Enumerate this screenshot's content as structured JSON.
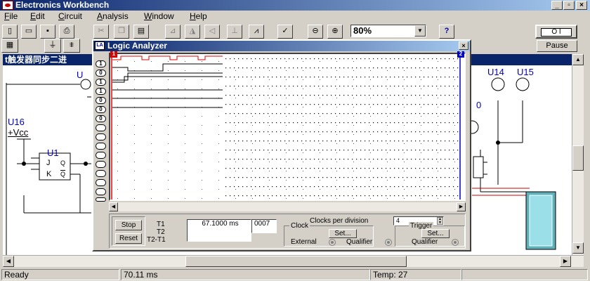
{
  "app": {
    "title": "Electronics Workbench",
    "circuit_title": "t触发器同步二进"
  },
  "menu": [
    {
      "label": "File",
      "u": "F",
      "rest": "ile"
    },
    {
      "label": "Edit",
      "u": "E",
      "rest": "dit"
    },
    {
      "label": "Circuit",
      "u": "C",
      "rest": "ircuit"
    },
    {
      "label": "Analysis",
      "u": "A",
      "rest": "nalysis"
    },
    {
      "label": "Window",
      "u": "W",
      "rest": "indow"
    },
    {
      "label": "Help",
      "u": "H",
      "rest": "elp"
    }
  ],
  "toolbar": {
    "zoom": "80%",
    "help_icon": "?",
    "pause_label": "Pause",
    "power_label": "O I"
  },
  "circuit": {
    "labels": {
      "u16": "U16",
      "vcc": "+Vcc",
      "u1": "U1",
      "u_left": "U",
      "u14": "U14",
      "u15": "U15",
      "zero": "0"
    },
    "ff": {
      "j": "J",
      "k": "K",
      "q": "Q",
      "qbar": "Q"
    }
  },
  "logic_analyzer": {
    "title": "Logic Analyzer",
    "marker1": "1",
    "marker2": "2",
    "channel_values": [
      "1",
      "0",
      "1",
      "1",
      "0",
      "0",
      "0",
      "",
      "",
      "",
      "",
      "",
      "",
      "",
      "",
      ""
    ],
    "stop_label": "Stop",
    "reset_label": "Reset",
    "t1_label": "T1",
    "t2_label": "T2",
    "t2t1_label": "T2-T1",
    "t1_value": "67.1000 ms",
    "side_value": "0007",
    "clocks_per_division_label": "Clocks per division",
    "clocks_per_division_value": "4",
    "clock_label": "Clock",
    "trigger_label": "Trigger",
    "set_label": "Set...",
    "external_label": "External",
    "qualifier_label": "Qualifier"
  },
  "status": {
    "ready": "Ready",
    "time": "70.11 ms",
    "temp": "Temp:  27"
  }
}
